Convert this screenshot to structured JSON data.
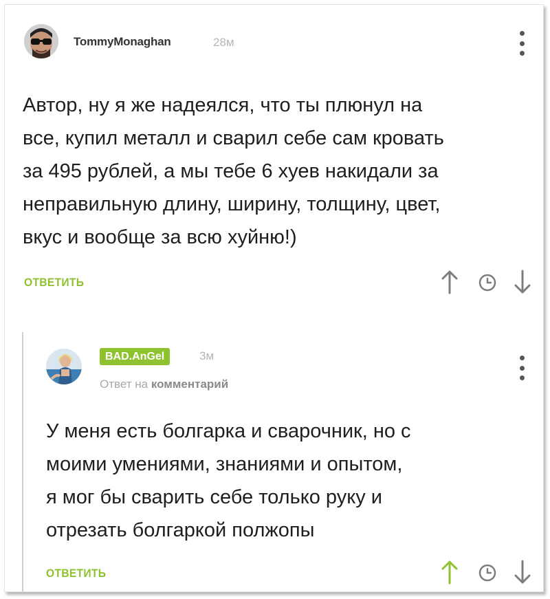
{
  "comments": [
    {
      "username": "TommyMonaghan",
      "time": "28м",
      "text_lines": [
        "Автор, ну я же надеялся, что ты плюнул на",
        "все, купил металл и сварил себе сам кровать",
        "за 495 рублей, а мы тебе 6 хуев накидали за",
        "неправильную длину, ширину, толщину, цвет,",
        "вкус и вообще за всю хуйню!)"
      ],
      "reply_label": "ОТВЕТИТЬ",
      "avatar_icon": "avatar-sunglasses-man",
      "upvoted": false
    },
    {
      "username": "BAD.AnGel",
      "time": "3м",
      "reply_to_prefix": "Ответ на",
      "reply_to_link": "комментарий",
      "text_lines": [
        "У меня есть болгарка и сварочник, но с",
        "моими умениями, знаниями и опытом,",
        "я мог бы сварить себе только руку и",
        "отрезать болгаркой полжопы"
      ],
      "reply_label": "ОТВЕТИТЬ",
      "avatar_icon": "avatar-girl-photo",
      "upvoted": true
    }
  ],
  "icons": {
    "more": "vertical-dots-icon",
    "upvote": "arrow-up-icon",
    "save": "clock-icon",
    "downvote": "arrow-down-icon"
  },
  "colors": {
    "accent": "#8ec22f",
    "icon_default": "#7d7d7d",
    "thread_line": "#cfcfcf"
  }
}
